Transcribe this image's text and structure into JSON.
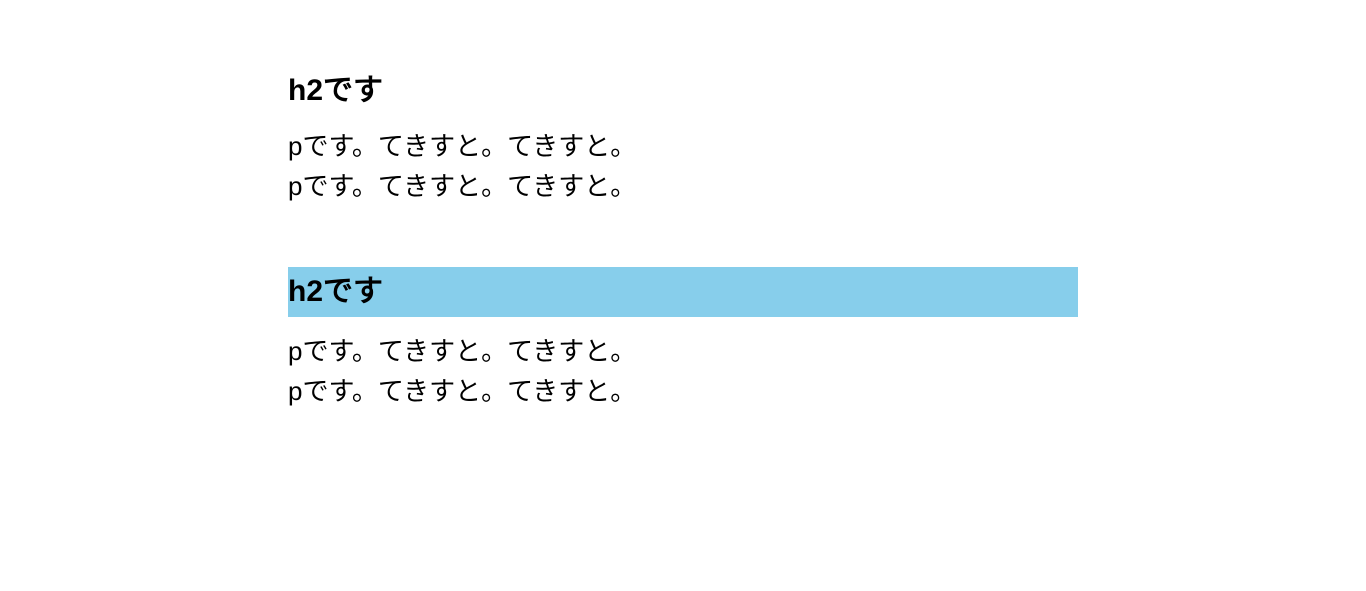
{
  "sections": [
    {
      "heading": "h2です",
      "paragraphs": [
        "pです。てきすと。てきすと。",
        "pです。てきすと。てきすと。"
      ],
      "highlight": false
    },
    {
      "heading": "h2です",
      "paragraphs": [
        "pです。てきすと。てきすと。",
        "pです。てきすと。てきすと。"
      ],
      "highlight": true
    }
  ]
}
